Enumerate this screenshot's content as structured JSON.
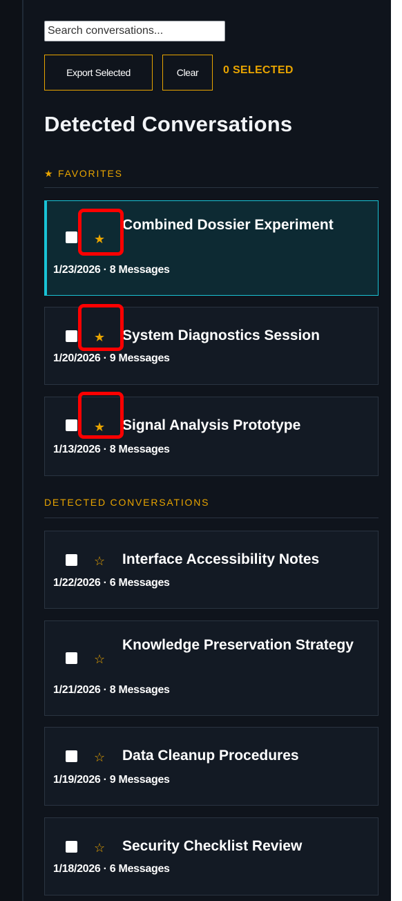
{
  "search": {
    "placeholder": "Search conversations..."
  },
  "toolbar": {
    "export_label": "Export Selected",
    "clear_label": "Clear",
    "selected_count": "0 SELECTED"
  },
  "heading": "Detected Conversations",
  "favorites": {
    "label": "★ FAVORITES",
    "items": [
      {
        "title": "Combined Dossier Experiment",
        "meta": "1/23/2026 · 8 Messages",
        "star": "★",
        "active": true
      },
      {
        "title": "System Diagnostics Session",
        "meta": "1/20/2026 · 9 Messages",
        "star": "★"
      },
      {
        "title": "Signal Analysis Prototype",
        "meta": "1/13/2026 · 8 Messages",
        "star": "★"
      }
    ]
  },
  "detected": {
    "label": "DETECTED CONVERSATIONS",
    "items": [
      {
        "title": "Interface Accessibility Notes",
        "meta": "1/22/2026 · 6 Messages",
        "star": "☆"
      },
      {
        "title": "Knowledge Preservation Strategy",
        "meta": "1/21/2026 · 8 Messages",
        "star": "☆"
      },
      {
        "title": "Data Cleanup Procedures",
        "meta": "1/19/2026 · 9 Messages",
        "star": "☆"
      },
      {
        "title": "Security Checklist Review",
        "meta": "1/18/2026 · 6 Messages",
        "star": "☆"
      }
    ]
  },
  "colors": {
    "accent": "#e8a400",
    "active_border": "#19c3d6",
    "panel_bg": "#0f141c",
    "annotation": "#ff0000"
  }
}
